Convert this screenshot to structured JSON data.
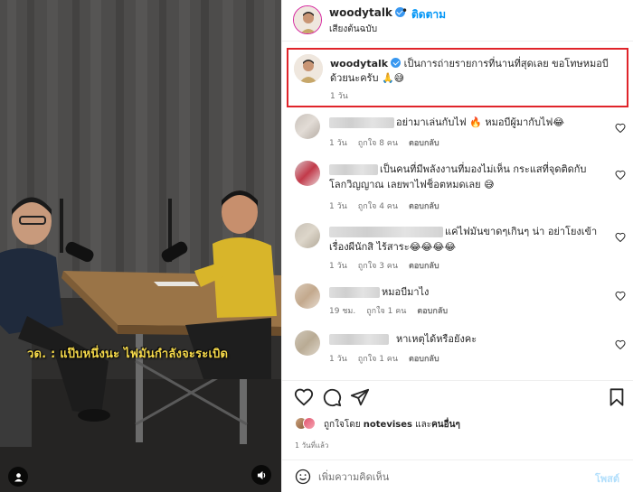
{
  "video": {
    "subtitle": "วด. : แป๊บหนึ่งนะ ไฟมันกำลังจะระเบิด",
    "user_tag_icon": "user-icon",
    "sound_icon": "speaker-icon"
  },
  "post": {
    "username": "woodytalk",
    "separator": "•",
    "follow_label": "ติดตาม",
    "subtitle": "เสียงต้นฉบับ",
    "caption": {
      "username": "woodytalk",
      "text": "เป็นการถ่ายรายการที่นานที่สุดเลย ขอโทษหมอบีด้วยนะครับ 🙏😅",
      "time": "1 วัน"
    }
  },
  "comments": [
    {
      "text": "อย่ามาเล่นกับไฟ 🔥 หมอบีผู้มากับไฟ😂",
      "time": "1 วัน",
      "likes": "ถูกใจ 8 คน",
      "reply": "ตอบกลับ"
    },
    {
      "text": "เป็นคนที่มีพลังงานที่มองไม่เห็น กระแสที่จุดติดกับโลกวิญญาณ เลยพาไฟช็อตหมดเลย 😅",
      "time": "1 วัน",
      "likes": "ถูกใจ 4 คน",
      "reply": "ตอบกลับ"
    },
    {
      "text": "แค่ไฟมันขาดๆเกินๆ น่า อย่าโยงเข้าเรื่องผีนักสิ ไร้สาระ😂😂😂😂",
      "time": "1 วัน",
      "likes": "ถูกใจ 3 คน",
      "reply": "ตอบกลับ"
    },
    {
      "text": "หมอบีมาไง",
      "time": "19 ชม.",
      "likes": "ถูกใจ 1 คน",
      "reply": "ตอบกลับ"
    },
    {
      "text": "หาเหตุได้หรือยังคะ",
      "time": "1 วัน",
      "likes": "ถูกใจ 1 คน",
      "reply": "ตอบกลับ"
    }
  ],
  "actions": {
    "like_icon": "heart-icon",
    "comment_icon": "comment-icon",
    "share_icon": "send-icon",
    "save_icon": "bookmark-icon"
  },
  "likes": {
    "prefix": "ถูกใจโดย",
    "user": "notevises",
    "joiner": "และ",
    "others": "คนอื่นๆ"
  },
  "post_time": "1 วันที่แล้ว",
  "comment_bar": {
    "emoji_icon": "emoji-icon",
    "placeholder": "เพิ่มความคิดเห็น",
    "post_label": "โพสต์"
  },
  "colors": {
    "accent": "#0095f6",
    "highlight_border": "#e0242a",
    "subtitle_yellow": "#f4d84a"
  }
}
